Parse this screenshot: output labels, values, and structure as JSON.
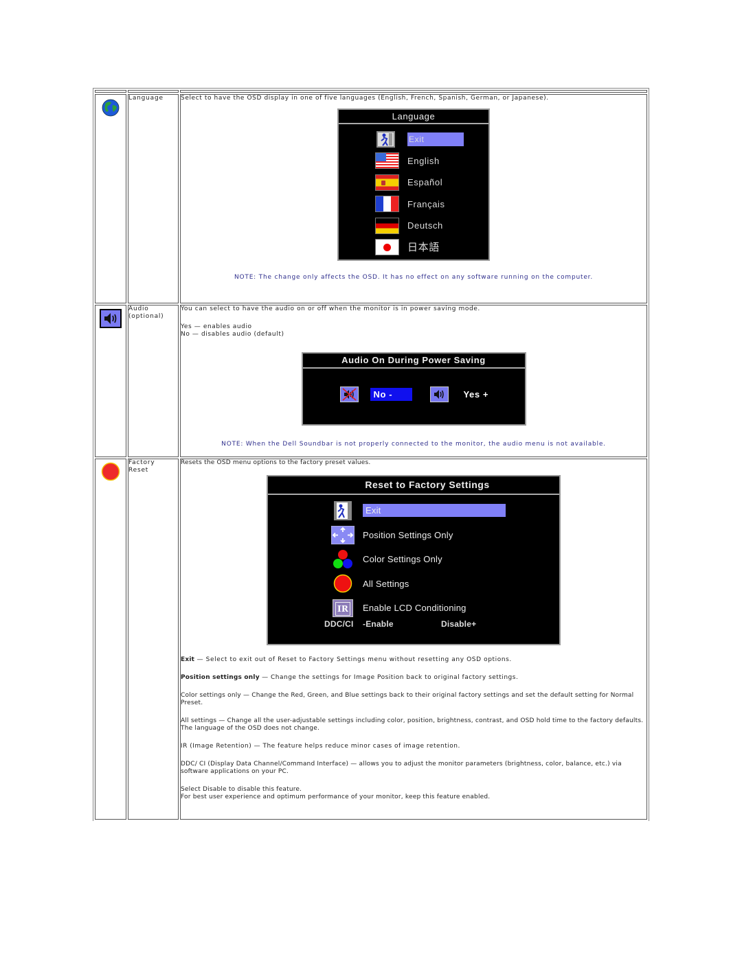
{
  "rows": [
    {
      "icon": "globe-icon",
      "label": "Language",
      "description": "Select to have the OSD display in one of five languages (English, French, Spanish, German, or Japanese).",
      "osd": {
        "title": "Language",
        "items": [
          {
            "icon": "exit-icon",
            "label": "Exit",
            "selected": true
          },
          {
            "icon": "flag-us-icon",
            "label": "English"
          },
          {
            "icon": "flag-es-icon",
            "label": "Español"
          },
          {
            "icon": "flag-fr-icon",
            "label": "Français"
          },
          {
            "icon": "flag-de-icon",
            "label": "Deutsch"
          },
          {
            "icon": "flag-jp-icon",
            "label": "日本語"
          }
        ]
      },
      "note": "NOTE: The change only affects the OSD. It has no effect on any software running on the computer."
    },
    {
      "icon": "speaker-icon",
      "label_line1": "Audio",
      "label_line2": "(optional)",
      "description": "You can select to have the audio on or off when the monitor is in power saving mode.",
      "option_yes": "Yes — enables audio",
      "option_no": "No — disables audio (default)",
      "osd": {
        "title": "Audio On During Power Saving",
        "no_label": "No -",
        "yes_label": "Yes +",
        "selected": "No"
      },
      "note": "NOTE: When the Dell Soundbar is not properly connected to the monitor, the audio menu is not available."
    },
    {
      "icon": "red-circle-icon",
      "label_line1": "Factory",
      "label_line2": "Reset",
      "description": "Resets the OSD menu options to  the factory preset values.",
      "osd": {
        "title": "Reset to Factory Settings",
        "items": [
          {
            "icon": "exit-icon",
            "label": "Exit",
            "selected": true
          },
          {
            "icon": "position-arrows-icon",
            "label": "Position Settings Only"
          },
          {
            "icon": "rgb-circles-icon",
            "label": "Color Settings Only"
          },
          {
            "icon": "red-circle-icon",
            "label": "All Settings"
          },
          {
            "icon": "ir-icon",
            "icon_text": "IR",
            "label": "Enable LCD Conditioning"
          }
        ],
        "ddc_label": "DDC/CI",
        "ddc_enable": "-Enable",
        "ddc_disable": "Disable+"
      },
      "details": {
        "exit_term": "Exit",
        "exit_text": " — Select to exit out of Reset to Factory Settings menu without resetting any OSD options.",
        "position_term": "Position settings only",
        "position_text": " — Change the settings for Image Position back to original factory settings.",
        "color_text": "Color settings only — Change the Red, Green, and Blue settings back to their original factory settings and set  the default setting for Normal Preset.",
        "all_text": "All settings —  Change all the user-adjustable settings including color, position, brightness, contrast, and OSD hold time  to the factory defaults. The language of the OSD does not change.",
        "ir_text": "IR (Image Retention) — The feature helps reduce minor cases of image retention.",
        "ddc_text": "DDC/ CI (Display Data Channel/Command Interface) — allows you to adjust the monitor parameters (brightness, color, balance, etc.)  via software applications on your PC.",
        "disable_text": "Select Disable to disable this feature.",
        "enable_text": "For best user experience and optimum performance of your monitor, keep this feature enabled."
      }
    }
  ],
  "colors": {
    "note_text": "#2e2e8c",
    "osd_highlight": "#8080f8",
    "osd_no_selected": "#1010ee"
  }
}
